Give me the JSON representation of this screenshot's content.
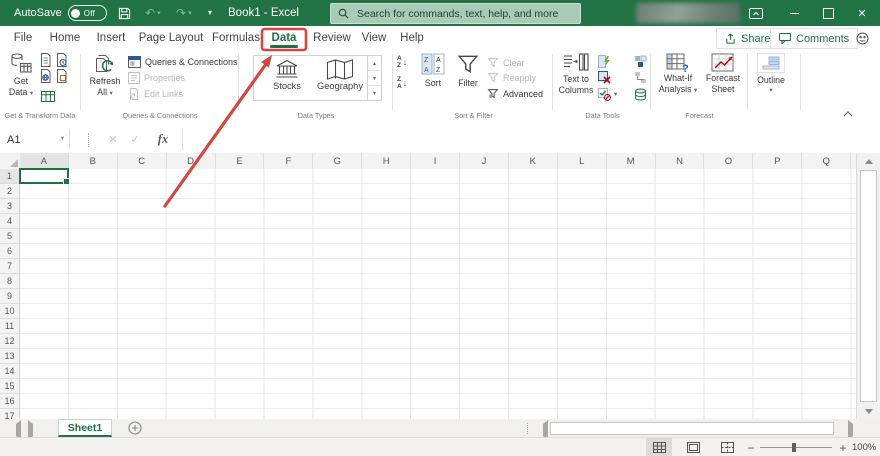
{
  "colors": {
    "excel_green": "#217346",
    "annotation_red": "#d8453c"
  },
  "titlebar": {
    "autosave_label": "AutoSave",
    "autosave_state": "Off",
    "document_title": "Book1 - Excel",
    "search_placeholder": "Search for commands, text, help, and more"
  },
  "menu": {
    "tabs": [
      {
        "label": "File"
      },
      {
        "label": "Home"
      },
      {
        "label": "Insert"
      },
      {
        "label": "Page Layout"
      },
      {
        "label": "Formulas"
      },
      {
        "label": "Data",
        "active": true
      },
      {
        "label": "Review"
      },
      {
        "label": "View"
      },
      {
        "label": "Help"
      }
    ],
    "share_label": "Share",
    "comments_label": "Comments"
  },
  "ribbon": {
    "get_transform": {
      "group_label": "Get & Transform Data",
      "get_data_line1": "Get",
      "get_data_line2": "Data"
    },
    "queries": {
      "group_label": "Queries & Connections",
      "refresh_line1": "Refresh",
      "refresh_line2": "All",
      "queries_connections": "Queries & Connections",
      "properties": "Properties",
      "edit_links": "Edit Links"
    },
    "data_types": {
      "group_label": "Data Types",
      "stocks": "Stocks",
      "geography": "Geography"
    },
    "sort_filter": {
      "group_label": "Sort & Filter",
      "sort": "Sort",
      "filter": "Filter",
      "clear": "Clear",
      "reapply": "Reapply",
      "advanced": "Advanced"
    },
    "data_tools": {
      "group_label": "Data Tools",
      "text_to_columns_line1": "Text to",
      "text_to_columns_line2": "Columns"
    },
    "forecast": {
      "group_label": "Forecast",
      "what_if_line1": "What-If",
      "what_if_line2": "Analysis",
      "forecast_sheet_line1": "Forecast",
      "forecast_sheet_line2": "Sheet"
    },
    "outline_group": {
      "outline": "Outline"
    }
  },
  "formula_bar": {
    "cell_reference": "A1",
    "fx_label": "fx"
  },
  "grid": {
    "columns": [
      "A",
      "B",
      "C",
      "D",
      "E",
      "F",
      "G",
      "H",
      "I",
      "J",
      "K",
      "L",
      "M",
      "N",
      "O",
      "P",
      "Q"
    ],
    "row_count": 17,
    "selected_cell": "A1"
  },
  "sheet_bar": {
    "active_sheet": "Sheet1"
  },
  "status_bar": {
    "zoom_level": "100%"
  },
  "icons": {
    "search-icon": "magnifier",
    "save-icon": "floppy-disk",
    "undo-icon": "↶",
    "redo-icon": "↷",
    "dropdown-caret-icon": "▾",
    "share-icon": "box-up-arrow",
    "comments-icon": "speech-bubble",
    "feedback-smiley-icon": "smiley-face",
    "add-sheet-icon": "circled-plus",
    "collapse-ribbon-icon": "chevron-up"
  }
}
